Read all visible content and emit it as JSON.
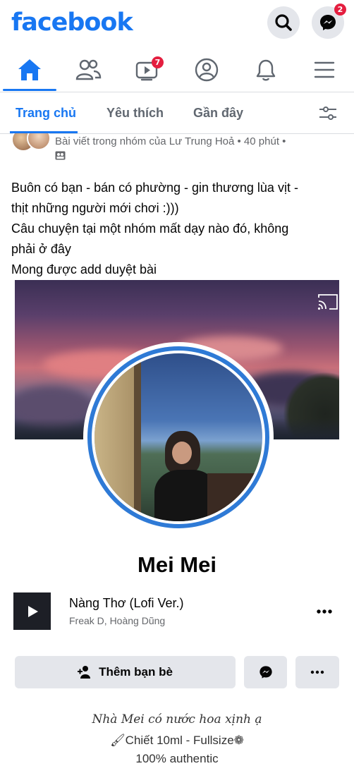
{
  "header": {
    "logo": "facebook",
    "messenger_badge": "2"
  },
  "nav": {
    "watch_badge": "7"
  },
  "feed_tabs": [
    "Trang chủ",
    "Yêu thích",
    "Gần đây"
  ],
  "post": {
    "meta": "Bài viết trong nhóm của Lư Trung Hoả • 40 phút •",
    "text_lines": [
      "Buôn có bạn - bán có phường - gin thương lùa vịt -",
      "thịt những người mới chơi :)))",
      "Câu chuyện tại một nhóm mất dạy nào đó, không",
      "phải ở đây",
      "Mong được add duyệt bài"
    ]
  },
  "profile": {
    "name": "Mei Mei",
    "music_title": "Nàng Thơ (Lofi Ver.)",
    "music_artist": "Freak D, Hoàng Dũng",
    "add_friend_label": "Thêm bạn bè",
    "bio_lines": [
      "Nhà Mei có nước hoa xịnh ạ",
      "Chiết 10ml - Fullsize",
      "100% authentic"
    ]
  },
  "colors": {
    "accent": "#1877f2",
    "badge": "#e41e3f"
  }
}
